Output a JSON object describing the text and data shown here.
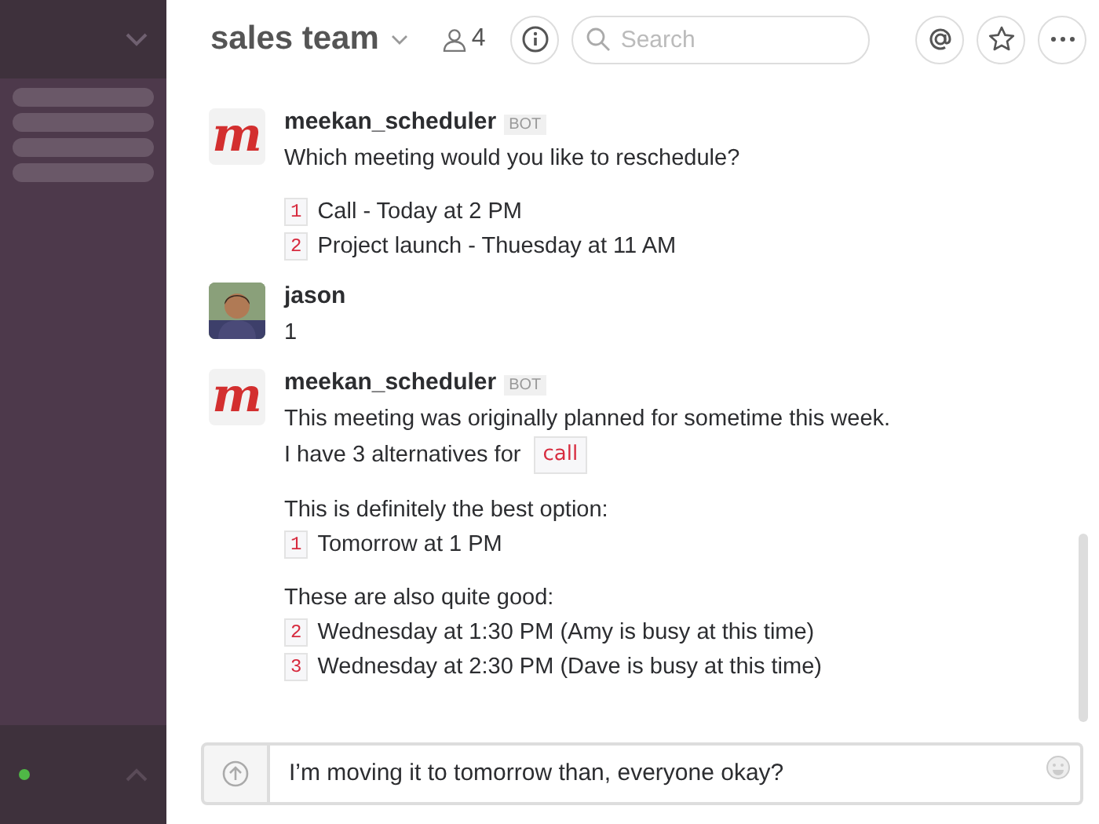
{
  "sidebar": {
    "online": true
  },
  "header": {
    "channel": "sales team",
    "member_count": "4",
    "search": {
      "placeholder": "Search"
    }
  },
  "messages": [
    {
      "author": "meekan_scheduler",
      "badge": "BOT",
      "kind": "bot",
      "avatar_text": "m",
      "paragraphs": [
        [
          {
            "kind": "text",
            "text": "Which meeting would you like to reschedule?"
          }
        ],
        [
          {
            "kind": "option",
            "number": "1",
            "text": "Call - Today at 2 PM"
          },
          {
            "kind": "option",
            "number": "2",
            "text": "Project launch - Thuesday at 11 AM"
          }
        ]
      ]
    },
    {
      "author": "jason",
      "kind": "user",
      "paragraphs": [
        [
          {
            "kind": "text",
            "text": "1"
          }
        ]
      ]
    },
    {
      "author": "meekan_scheduler",
      "badge": "BOT",
      "kind": "bot",
      "avatar_text": "m",
      "paragraphs": [
        [
          {
            "kind": "text",
            "text": "This meeting was originally planned for sometime this week."
          },
          {
            "kind": "code",
            "text": "I have 3 alternatives for",
            "code": "call"
          }
        ],
        [
          {
            "kind": "text",
            "text": "This is definitely the best option:"
          },
          {
            "kind": "option",
            "number": "1",
            "text": "Tomorrow at 1 PM"
          }
        ],
        [
          {
            "kind": "text",
            "text": "These are also quite good:"
          },
          {
            "kind": "option",
            "number": "2",
            "text": "Wednesday at 1:30 PM (Amy is busy at this time)"
          },
          {
            "kind": "option",
            "number": "3",
            "text": "Wednesday at 2:30 PM (Dave is busy at this time)"
          }
        ]
      ]
    }
  ],
  "composer": {
    "value": "I’m moving it to tomorrow than, everyone okay?"
  }
}
